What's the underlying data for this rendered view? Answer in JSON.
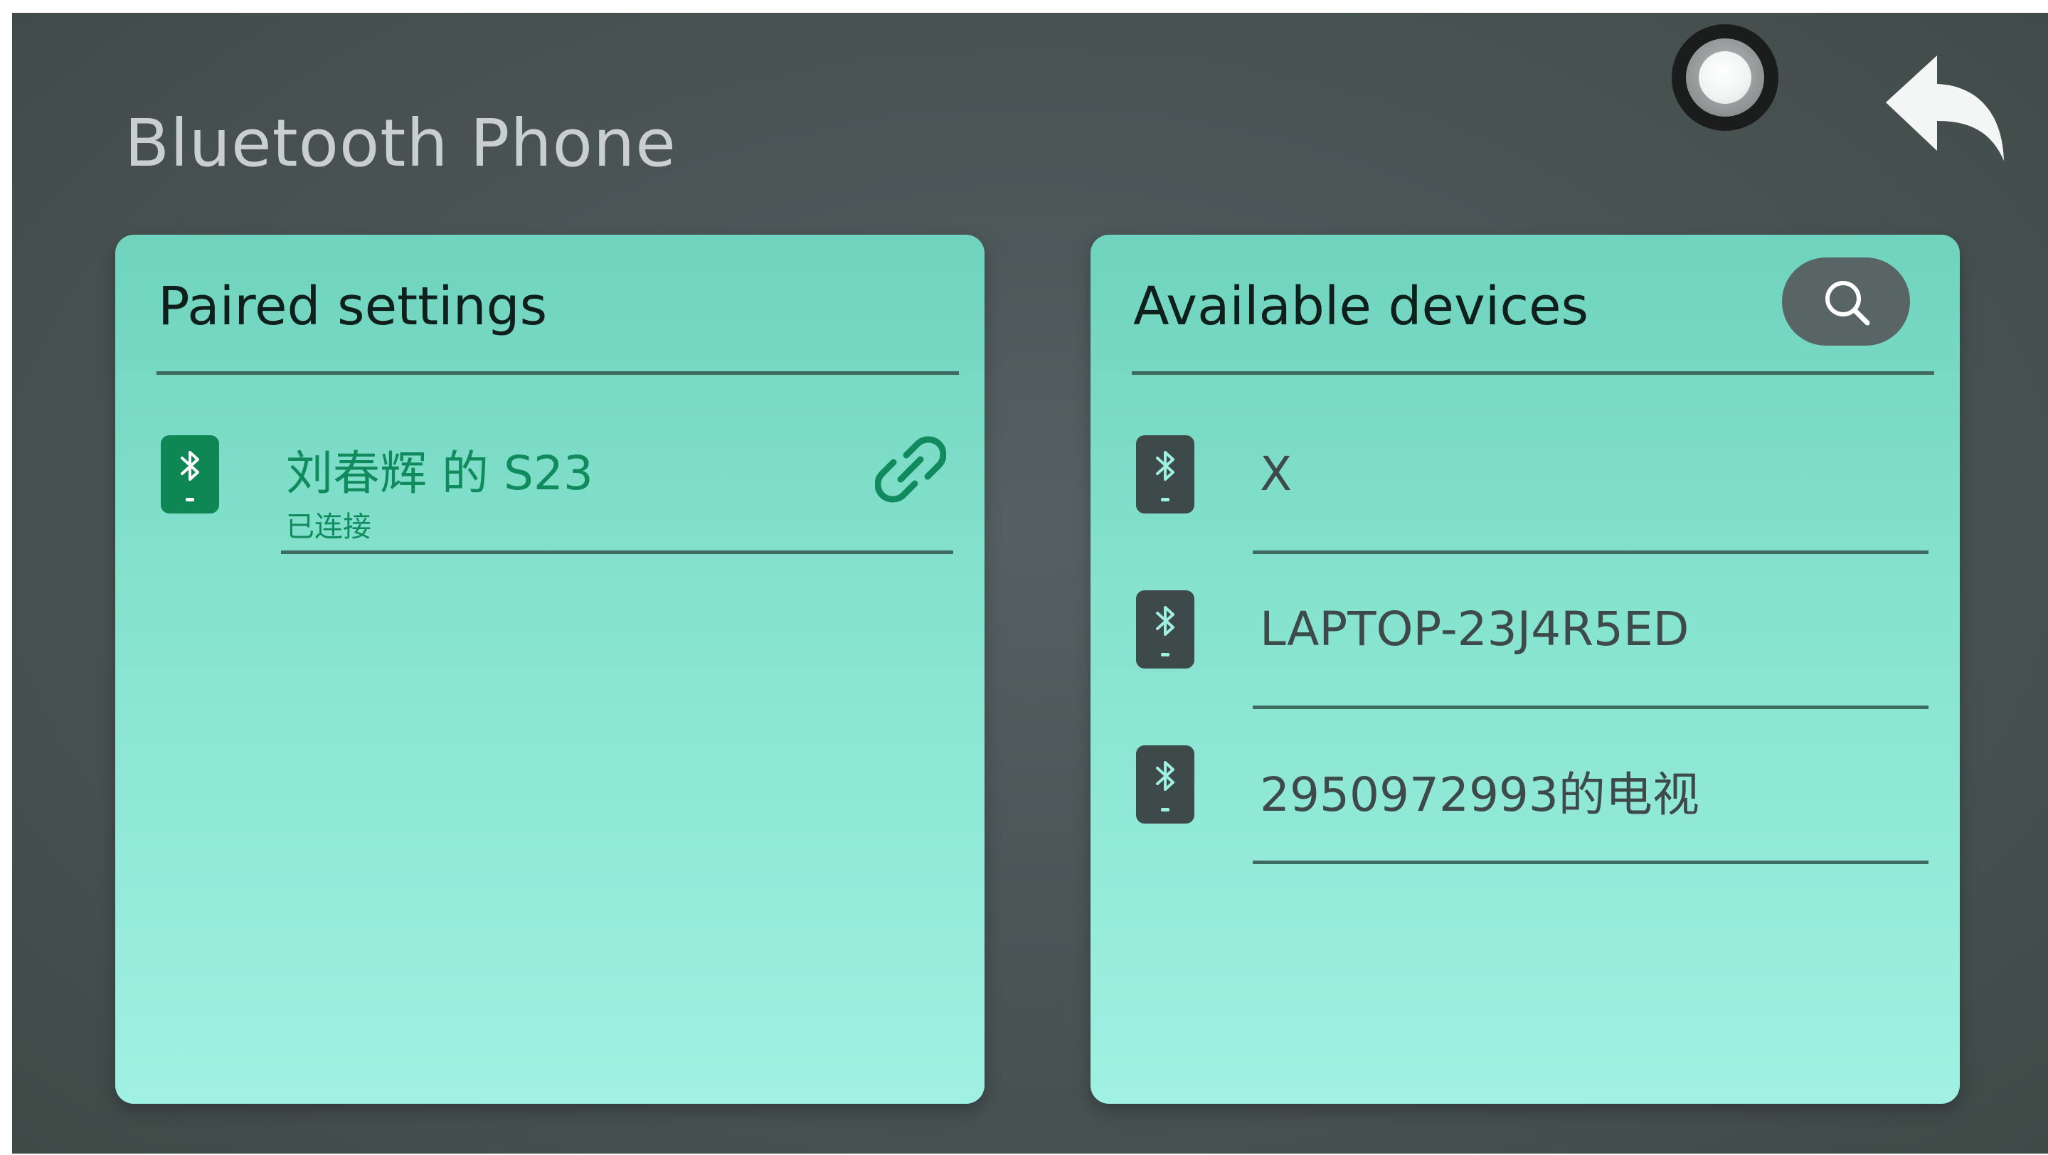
{
  "header": {
    "title": "Bluetooth Phone",
    "home_icon": "home-circle-icon",
    "back_icon": "back-arrow-icon"
  },
  "paired_panel": {
    "title": "Paired settings",
    "devices": [
      {
        "name": "刘春辉 的 S23",
        "status": "已连接",
        "icon": "bluetooth-phone-icon",
        "action_icon": "link-icon"
      }
    ]
  },
  "available_panel": {
    "title": "Available devices",
    "search_icon": "search-icon",
    "devices": [
      {
        "name": "X",
        "icon": "bluetooth-phone-icon"
      },
      {
        "name": "LAPTOP-23J4R5ED",
        "icon": "bluetooth-phone-icon"
      },
      {
        "name": "2950972993的电视",
        "icon": "bluetooth-phone-icon"
      }
    ]
  },
  "colors": {
    "background": "#4b5556",
    "panel_top": "#6fd3bd",
    "panel_bottom": "#a0f1e3",
    "paired_accent": "#0e8755",
    "available_icon": "#3e4a49",
    "title_text": "#c9cfd1"
  }
}
